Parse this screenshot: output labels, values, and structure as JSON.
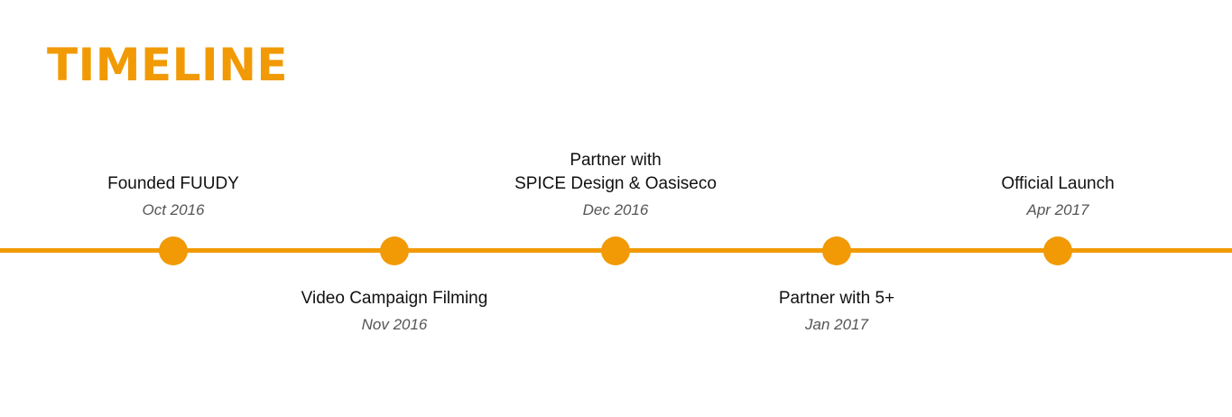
{
  "title": "TIMELINE",
  "colors": {
    "accent": "#F19A06",
    "event_text": "#111111",
    "date_text": "#555555"
  },
  "milestones": [
    {
      "event": "Founded FUUDY",
      "date": "Oct 2016",
      "position": "above"
    },
    {
      "event": "Video Campaign Filming",
      "date": "Nov 2016",
      "position": "below"
    },
    {
      "event": "Partner with\nSPICE Design & Oasiseco",
      "date": "Dec 2016",
      "position": "above"
    },
    {
      "event": "Partner with 5+",
      "date": "Jan 2017",
      "position": "below"
    },
    {
      "event": "Official Launch",
      "date": "Apr 2017",
      "position": "above"
    }
  ]
}
